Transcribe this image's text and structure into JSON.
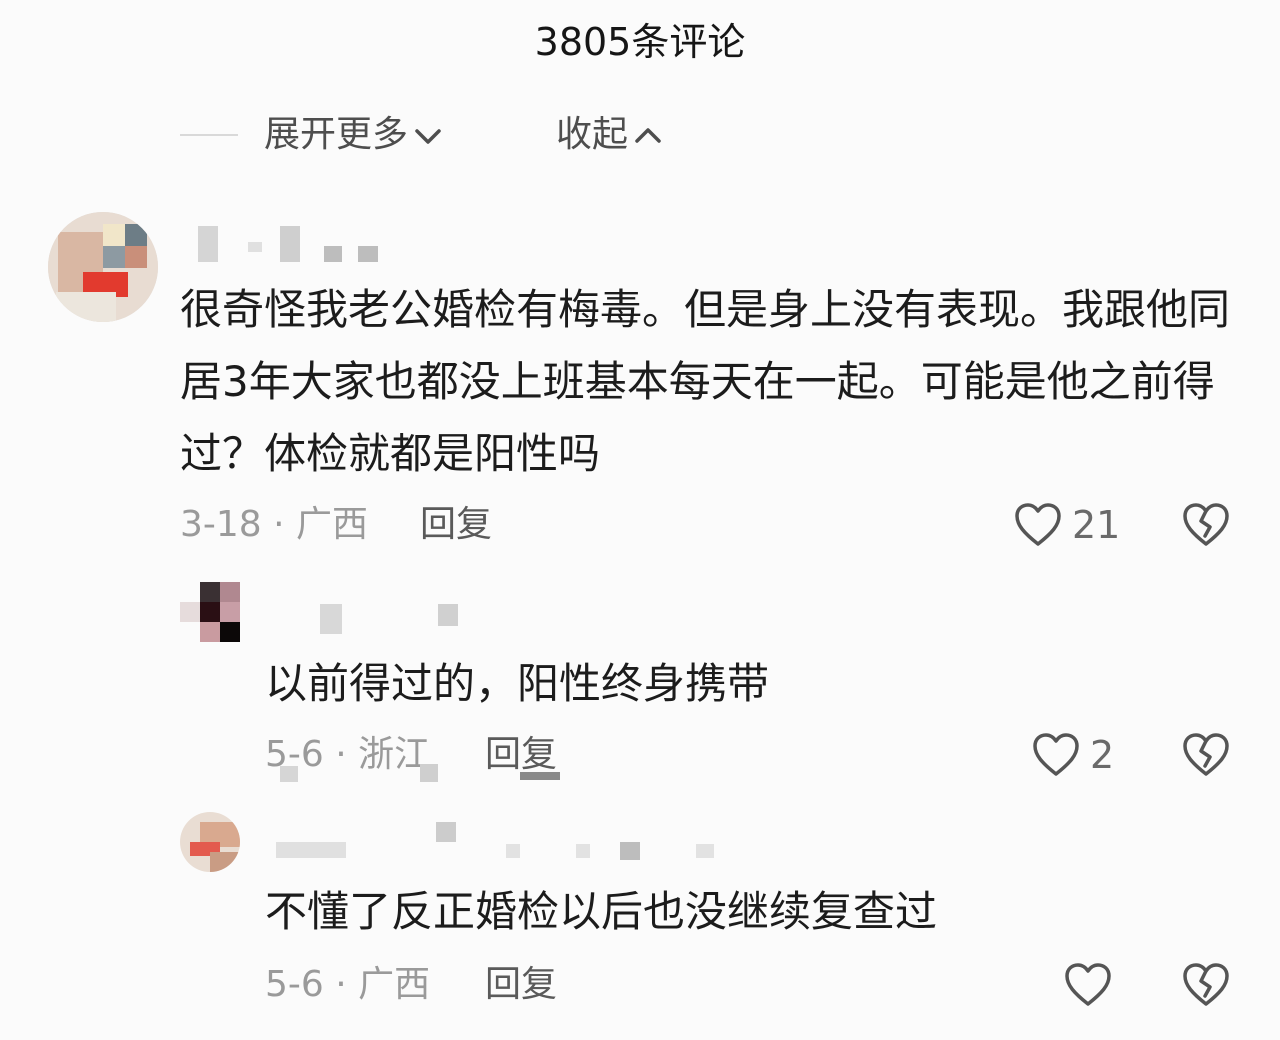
{
  "header": {
    "title": "3805条评论"
  },
  "thread_controls": {
    "expand_label": "展开更多",
    "collapse_label": "收起"
  },
  "comments": [
    {
      "text": "很奇怪我老公婚检有梅毒。但是身上没有表现。我跟他同居3年大家也都没上班基本每天在一起。可能是他之前得过？体检就都是阳性吗",
      "date_location": "3-18 · 广西",
      "reply_label": "回复",
      "likes": "21",
      "like_icon": "heart-outline-icon",
      "dislike_icon": "broken-heart-icon"
    },
    {
      "text": "以前得过的，阳性终身携带",
      "date_location": "5-6 · 浙江",
      "reply_label": "回复",
      "likes": "2",
      "like_icon": "heart-outline-icon",
      "dislike_icon": "broken-heart-icon"
    },
    {
      "text": "不懂了反正婚检以后也没继续复查过",
      "date_location": "5-6 · 广西",
      "reply_label": "回复",
      "like_icon": "heart-outline-icon",
      "dislike_icon": "broken-heart-icon"
    }
  ],
  "colors": {
    "background": "#fbfbfb",
    "text": "#1c1c1c",
    "meta": "#9a9a9a",
    "icon": "#555555"
  }
}
